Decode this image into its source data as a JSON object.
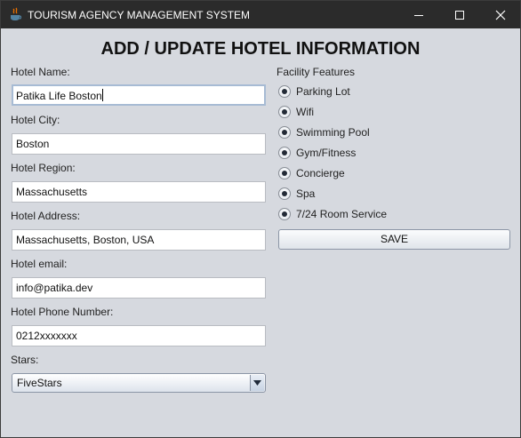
{
  "window": {
    "title": "TOURISM AGENCY MANAGEMENT SYSTEM",
    "icon": "java-icon",
    "controls": [
      "minimize-icon",
      "maximize-icon",
      "close-icon"
    ]
  },
  "heading": "ADD / UPDATE HOTEL INFORMATION",
  "form": {
    "name_label": "Hotel Name:",
    "name_value": "Patika Life Boston",
    "city_label": "Hotel City:",
    "city_value": "Boston",
    "region_label": "Hotel Region:",
    "region_value": "Massachusetts",
    "address_label": "Hotel Address:",
    "address_value": "Massachusetts, Boston, USA",
    "email_label": "Hotel email:",
    "email_value": "info@patika.dev",
    "phone_label": "Hotel Phone Number:",
    "phone_value": "0212xxxxxxx",
    "stars_label": "Stars:",
    "stars_value": "FiveStars"
  },
  "facilities": {
    "label": "Facility Features",
    "items": [
      {
        "label": "Parking Lot",
        "selected": true
      },
      {
        "label": "Wifi",
        "selected": true
      },
      {
        "label": "Swimming Pool",
        "selected": true
      },
      {
        "label": "Gym/Fitness",
        "selected": true
      },
      {
        "label": "Concierge",
        "selected": true
      },
      {
        "label": "Spa",
        "selected": true
      },
      {
        "label": "7/24 Room Service",
        "selected": true
      }
    ]
  },
  "save_label": "SAVE",
  "colors": {
    "titlebar": "#2b2b2b",
    "window_bg": "#d6d9df",
    "field_focus_border": "#a7bbd4"
  }
}
